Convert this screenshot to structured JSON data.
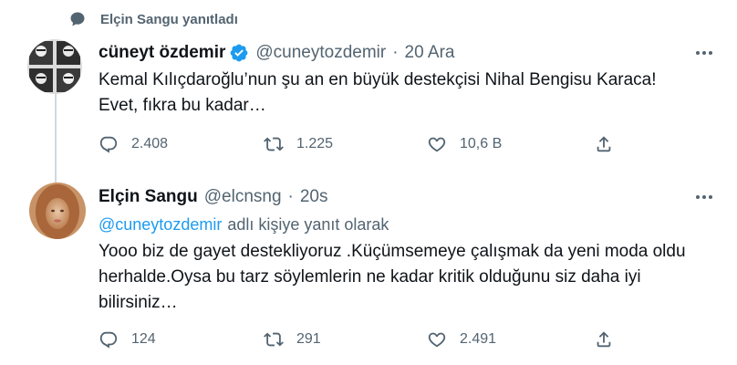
{
  "context": {
    "text": "Elçin Sangu yanıtladı",
    "icon": "speech-bubble-icon"
  },
  "tweet1": {
    "name": "cüneyt özdemir",
    "handle": "@cuneytozdemir",
    "dot": "·",
    "time": "20 Ara",
    "verified": true,
    "text_line1": "Kemal Kılıçdaroğlu’nun şu an en büyük destekçisi Nihal Bengisu Karaca!",
    "text_line2": "Evet, fıkra bu kadar…",
    "replies": "2.408",
    "retweets": "1.225",
    "likes": "10,6 B"
  },
  "tweet2": {
    "name": "Elçin Sangu",
    "handle": "@elcnsng",
    "dot": "·",
    "time": "20s",
    "reply_to_handle": "@cuneytozdemir",
    "reply_to_suffix": "adlı kişiye yanıt olarak",
    "text_line1": "Yooo biz de gayet destekliyoruz .Küçümsemeye çalışmak da yeni moda oldu",
    "text_line2": "herhalde.Oysa bu tarz söylemlerin ne kadar kritik olduğunu siz daha iyi",
    "text_line3": "bilirsiniz…",
    "replies": "124",
    "retweets": "291",
    "likes": "2.491"
  },
  "colors": {
    "accent": "#1d9bf0",
    "muted": "#536471",
    "text": "#0f1419",
    "line": "#cfd9de"
  }
}
